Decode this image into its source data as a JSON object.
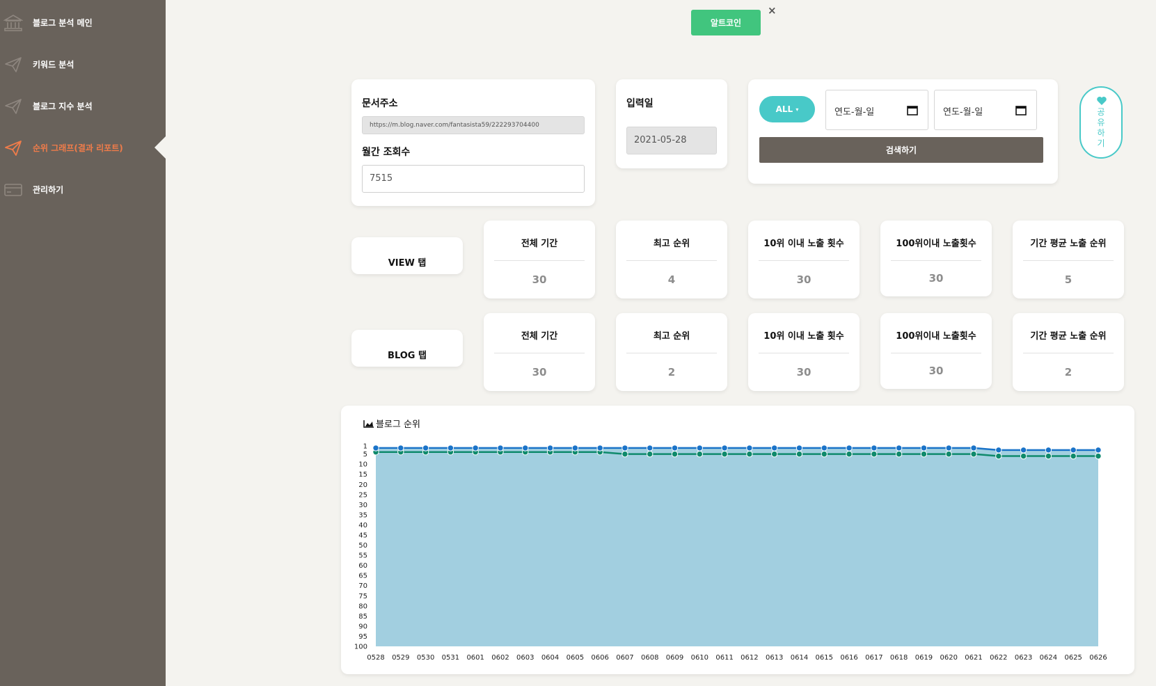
{
  "sidebar": {
    "items": [
      {
        "label": "블로그 분석 메인",
        "icon": "bank-icon",
        "active": false
      },
      {
        "label": "키워드 분석",
        "icon": "paper-plane-icon",
        "active": false
      },
      {
        "label": "블로그 지수 분석",
        "icon": "paper-plane-icon",
        "active": false
      },
      {
        "label": "순위 그래프(결과 리포트)",
        "icon": "paper-plane-icon",
        "active": true
      },
      {
        "label": "관리하기",
        "icon": "card-icon",
        "active": false
      }
    ]
  },
  "top": {
    "button_label": "알트코인",
    "close_label": "×"
  },
  "doc": {
    "url_label": "문서주소",
    "url_value": "https://m.blog.naver.com/fantasista59/222293704400",
    "views_label": "월간 조회수",
    "views_value": "7515"
  },
  "input_date": {
    "label": "입력일",
    "value": "2021-05-28"
  },
  "search": {
    "all_label": "ALL",
    "start_placeholder": "연도-월-일",
    "end_placeholder": "연도-월-일",
    "button_label": "검색하기"
  },
  "share": {
    "chars": [
      "공",
      "유",
      "하",
      "기"
    ]
  },
  "stats": {
    "headers": [
      "전체 기간",
      "최고 순위",
      "10위 이내 노출 횟수",
      "100위이내 노출횟수",
      "기간 평균 노출 순위"
    ],
    "view": {
      "tab_label": "VIEW 탭",
      "values": [
        "30",
        "4",
        "30",
        "30",
        "5"
      ]
    },
    "blog": {
      "tab_label": "BLOG 탭",
      "values": [
        "30",
        "2",
        "30",
        "30",
        "2"
      ]
    }
  },
  "chart_title": "블로그 순위",
  "colors": {
    "blue_series": "#1a73c8",
    "green_series": "#0f8a6c",
    "area_fill": "#a2cfe0"
  },
  "chart_data": {
    "type": "line",
    "title": "블로그 순위",
    "x": [
      "0528",
      "0529",
      "0530",
      "0531",
      "0601",
      "0602",
      "0603",
      "0604",
      "0605",
      "0606",
      "0607",
      "0608",
      "0609",
      "0610",
      "0611",
      "0612",
      "0613",
      "0614",
      "0615",
      "0616",
      "0617",
      "0618",
      "0619",
      "0620",
      "0621",
      "0622",
      "0623",
      "0624",
      "0625",
      "0626"
    ],
    "y_ticks": [
      1,
      5,
      10,
      15,
      20,
      25,
      30,
      35,
      40,
      45,
      50,
      55,
      60,
      65,
      70,
      75,
      80,
      85,
      90,
      95,
      100
    ],
    "ylim": [
      1,
      100
    ],
    "y_inverted": true,
    "series": [
      {
        "color": "#1a73c8",
        "values": [
          2,
          2,
          2,
          2,
          2,
          2,
          2,
          2,
          2,
          2,
          2,
          2,
          2,
          2,
          2,
          2,
          2,
          2,
          2,
          2,
          2,
          2,
          2,
          2,
          2,
          3,
          3,
          3,
          3,
          3
        ]
      },
      {
        "color": "#0f8a6c",
        "values": [
          4,
          4,
          4,
          4,
          4,
          4,
          4,
          4,
          4,
          4,
          5,
          5,
          5,
          5,
          5,
          5,
          5,
          5,
          5,
          5,
          5,
          5,
          5,
          5,
          5,
          6,
          6,
          6,
          6,
          6
        ]
      }
    ]
  }
}
